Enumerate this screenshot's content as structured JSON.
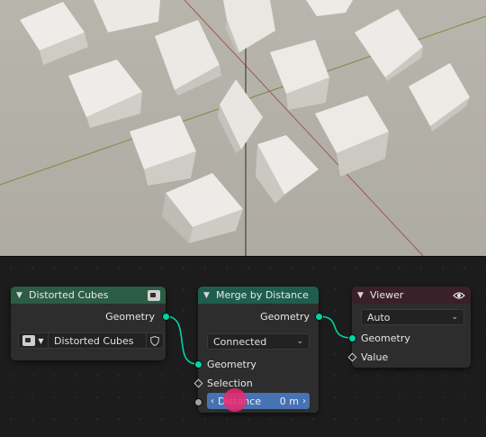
{
  "nodes": {
    "distorted_cubes": {
      "title": "Distorted Cubes",
      "output_geometry": "Geometry",
      "group_name": "Distorted Cubes"
    },
    "merge_by_distance": {
      "title": "Merge by Distance",
      "output_geometry": "Geometry",
      "mode": "Connected",
      "input_geometry": "Geometry",
      "input_selection": "Selection",
      "distance_label": "Distance",
      "distance_value": "0 m"
    },
    "viewer": {
      "title": "Viewer",
      "domain": "Auto",
      "input_geometry": "Geometry",
      "input_value": "Value"
    }
  },
  "colors": {
    "geometry_socket": "#00d6a3",
    "distance_slider": "#4772b3",
    "click_cursor": "#ec286e"
  }
}
